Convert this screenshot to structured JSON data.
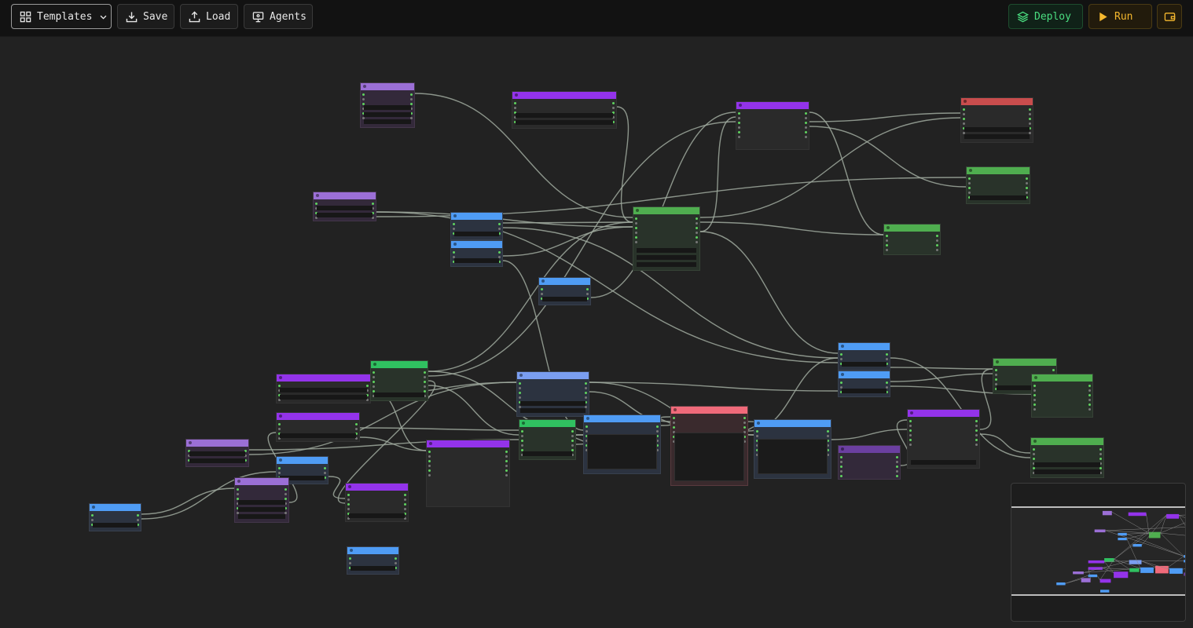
{
  "toolbar": {
    "templates_label": "Templates",
    "save_label": "Save",
    "load_label": "Load",
    "agents_label": "Agents",
    "deploy_label": "Deploy",
    "run_label": "Run"
  },
  "icons": {
    "templates": "grid-icon",
    "templates_caret": "chevron-down-icon",
    "save": "download-icon",
    "load": "upload-icon",
    "agents": "monitor-icon",
    "deploy": "layers-icon",
    "run": "play-icon",
    "wallet": "wallet-icon"
  },
  "colors": {
    "canvas": "#222222",
    "toolbar": "#121212",
    "edge": "#9fa99d",
    "port": "#5fd35f",
    "deploy_accent": "#4ade80",
    "run_accent": "#f5b82e",
    "node_headers": {
      "purple": "#9333ea",
      "lavender": "#9b6fd6",
      "blue": "#4f9cf5",
      "green": "#4fae4f",
      "bright_green": "#30c060",
      "red": "#c94d4d",
      "pink": "#f06a7a",
      "periwinkle": "#7a9ef0",
      "violet": "#6b3fa0"
    }
  }
}
